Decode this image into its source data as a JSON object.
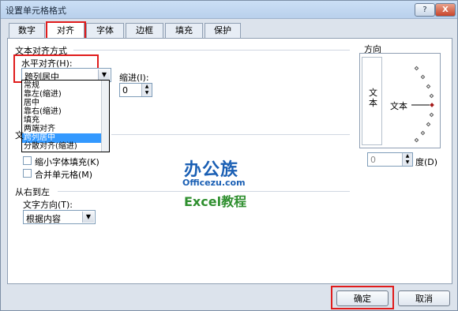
{
  "window": {
    "title": "设置单元格格式",
    "help_label": "?",
    "close_label": "X"
  },
  "tabs": [
    "数字",
    "对齐",
    "字体",
    "边框",
    "填充",
    "保护"
  ],
  "text_alignment": {
    "group_label": "文本对齐方式",
    "horizontal_label": "水平对齐(H):",
    "horizontal_value": "跨列居中",
    "indent_label": "缩进(I):",
    "indent_value": "0",
    "horizontal_options": [
      "常规",
      "靠左(缩进)",
      "居中",
      "靠右(缩进)",
      "填充",
      "两端对齐",
      "跨列居中",
      "分散对齐(缩进)"
    ],
    "selected_index": 6
  },
  "text_control": {
    "group_label_partial": "文",
    "shrink_label": "缩小字体填充(K)",
    "merge_label": "合并单元格(M)"
  },
  "rtl": {
    "group_label": "从右到左",
    "direction_label": "文字方向(T):",
    "direction_value": "根据内容"
  },
  "orientation": {
    "label": "方向",
    "vertical_text": "文本",
    "dial_text": "文本",
    "degree_value": "0",
    "degree_label": "度(D)"
  },
  "watermark": {
    "line1": "办公族",
    "line2": "Officezu.com",
    "line3": "Excel教程"
  },
  "buttons": {
    "ok": "确定",
    "cancel": "取消"
  }
}
